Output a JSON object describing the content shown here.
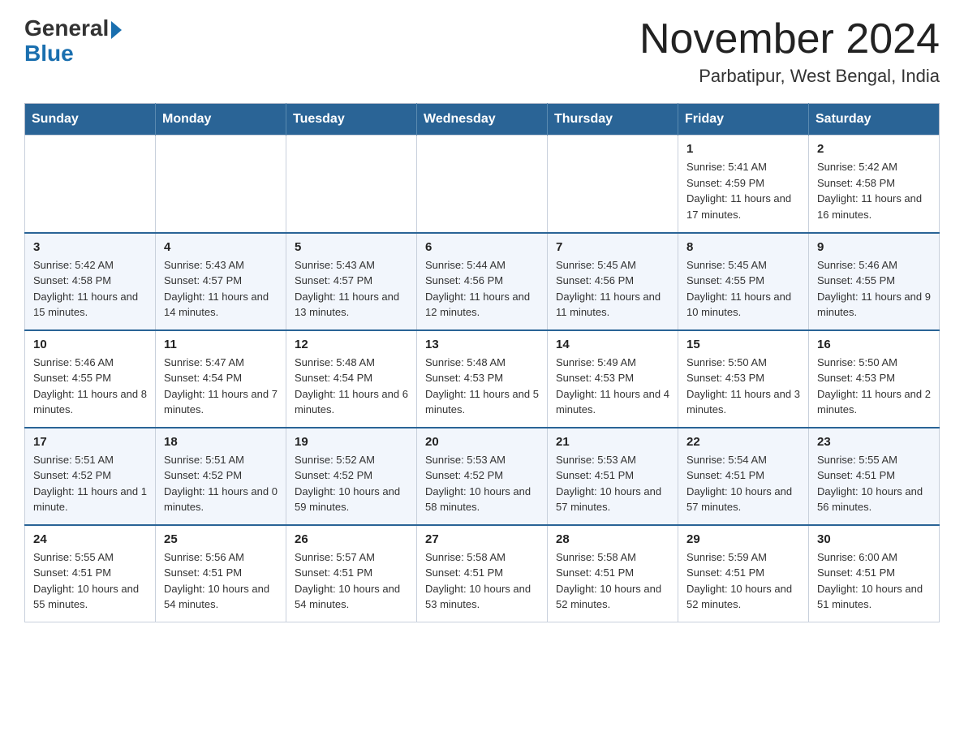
{
  "header": {
    "logo_general": "General",
    "logo_blue": "Blue",
    "month_title": "November 2024",
    "location": "Parbatipur, West Bengal, India"
  },
  "days_of_week": [
    "Sunday",
    "Monday",
    "Tuesday",
    "Wednesday",
    "Thursday",
    "Friday",
    "Saturday"
  ],
  "weeks": [
    [
      {
        "day": "",
        "info": ""
      },
      {
        "day": "",
        "info": ""
      },
      {
        "day": "",
        "info": ""
      },
      {
        "day": "",
        "info": ""
      },
      {
        "day": "",
        "info": ""
      },
      {
        "day": "1",
        "info": "Sunrise: 5:41 AM\nSunset: 4:59 PM\nDaylight: 11 hours and 17 minutes."
      },
      {
        "day": "2",
        "info": "Sunrise: 5:42 AM\nSunset: 4:58 PM\nDaylight: 11 hours and 16 minutes."
      }
    ],
    [
      {
        "day": "3",
        "info": "Sunrise: 5:42 AM\nSunset: 4:58 PM\nDaylight: 11 hours and 15 minutes."
      },
      {
        "day": "4",
        "info": "Sunrise: 5:43 AM\nSunset: 4:57 PM\nDaylight: 11 hours and 14 minutes."
      },
      {
        "day": "5",
        "info": "Sunrise: 5:43 AM\nSunset: 4:57 PM\nDaylight: 11 hours and 13 minutes."
      },
      {
        "day": "6",
        "info": "Sunrise: 5:44 AM\nSunset: 4:56 PM\nDaylight: 11 hours and 12 minutes."
      },
      {
        "day": "7",
        "info": "Sunrise: 5:45 AM\nSunset: 4:56 PM\nDaylight: 11 hours and 11 minutes."
      },
      {
        "day": "8",
        "info": "Sunrise: 5:45 AM\nSunset: 4:55 PM\nDaylight: 11 hours and 10 minutes."
      },
      {
        "day": "9",
        "info": "Sunrise: 5:46 AM\nSunset: 4:55 PM\nDaylight: 11 hours and 9 minutes."
      }
    ],
    [
      {
        "day": "10",
        "info": "Sunrise: 5:46 AM\nSunset: 4:55 PM\nDaylight: 11 hours and 8 minutes."
      },
      {
        "day": "11",
        "info": "Sunrise: 5:47 AM\nSunset: 4:54 PM\nDaylight: 11 hours and 7 minutes."
      },
      {
        "day": "12",
        "info": "Sunrise: 5:48 AM\nSunset: 4:54 PM\nDaylight: 11 hours and 6 minutes."
      },
      {
        "day": "13",
        "info": "Sunrise: 5:48 AM\nSunset: 4:53 PM\nDaylight: 11 hours and 5 minutes."
      },
      {
        "day": "14",
        "info": "Sunrise: 5:49 AM\nSunset: 4:53 PM\nDaylight: 11 hours and 4 minutes."
      },
      {
        "day": "15",
        "info": "Sunrise: 5:50 AM\nSunset: 4:53 PM\nDaylight: 11 hours and 3 minutes."
      },
      {
        "day": "16",
        "info": "Sunrise: 5:50 AM\nSunset: 4:53 PM\nDaylight: 11 hours and 2 minutes."
      }
    ],
    [
      {
        "day": "17",
        "info": "Sunrise: 5:51 AM\nSunset: 4:52 PM\nDaylight: 11 hours and 1 minute."
      },
      {
        "day": "18",
        "info": "Sunrise: 5:51 AM\nSunset: 4:52 PM\nDaylight: 11 hours and 0 minutes."
      },
      {
        "day": "19",
        "info": "Sunrise: 5:52 AM\nSunset: 4:52 PM\nDaylight: 10 hours and 59 minutes."
      },
      {
        "day": "20",
        "info": "Sunrise: 5:53 AM\nSunset: 4:52 PM\nDaylight: 10 hours and 58 minutes."
      },
      {
        "day": "21",
        "info": "Sunrise: 5:53 AM\nSunset: 4:51 PM\nDaylight: 10 hours and 57 minutes."
      },
      {
        "day": "22",
        "info": "Sunrise: 5:54 AM\nSunset: 4:51 PM\nDaylight: 10 hours and 57 minutes."
      },
      {
        "day": "23",
        "info": "Sunrise: 5:55 AM\nSunset: 4:51 PM\nDaylight: 10 hours and 56 minutes."
      }
    ],
    [
      {
        "day": "24",
        "info": "Sunrise: 5:55 AM\nSunset: 4:51 PM\nDaylight: 10 hours and 55 minutes."
      },
      {
        "day": "25",
        "info": "Sunrise: 5:56 AM\nSunset: 4:51 PM\nDaylight: 10 hours and 54 minutes."
      },
      {
        "day": "26",
        "info": "Sunrise: 5:57 AM\nSunset: 4:51 PM\nDaylight: 10 hours and 54 minutes."
      },
      {
        "day": "27",
        "info": "Sunrise: 5:58 AM\nSunset: 4:51 PM\nDaylight: 10 hours and 53 minutes."
      },
      {
        "day": "28",
        "info": "Sunrise: 5:58 AM\nSunset: 4:51 PM\nDaylight: 10 hours and 52 minutes."
      },
      {
        "day": "29",
        "info": "Sunrise: 5:59 AM\nSunset: 4:51 PM\nDaylight: 10 hours and 52 minutes."
      },
      {
        "day": "30",
        "info": "Sunrise: 6:00 AM\nSunset: 4:51 PM\nDaylight: 10 hours and 51 minutes."
      }
    ]
  ]
}
